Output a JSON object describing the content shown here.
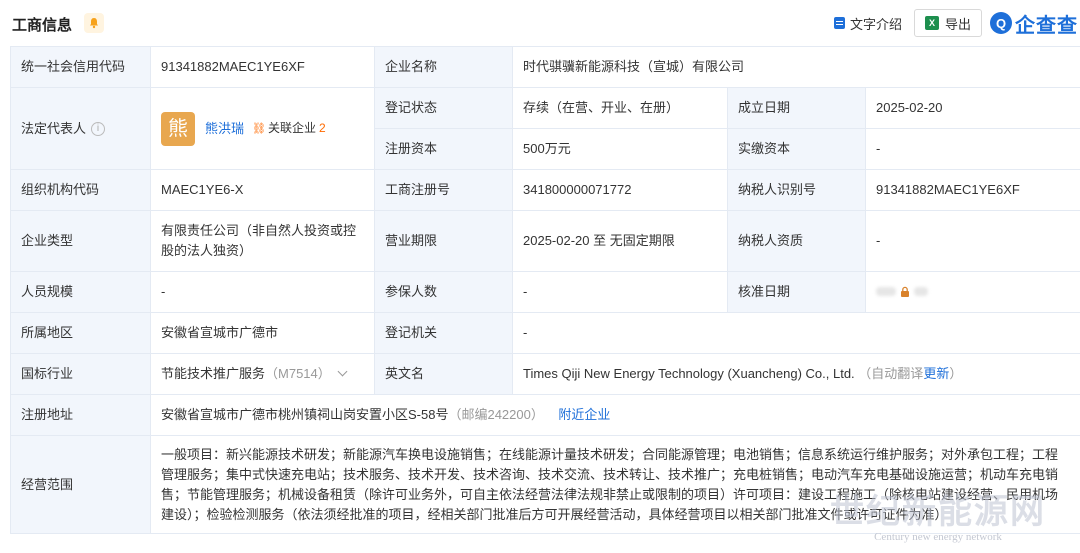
{
  "header": {
    "title": "工商信息",
    "tools": {
      "text_intro": "文字介绍",
      "export": "导出",
      "brand": "企查查",
      "brand_logo_char": "Q"
    }
  },
  "fields": {
    "credit_code": {
      "label": "统一社会信用代码",
      "value": "91341882MAEC1YE6XF"
    },
    "company_name": {
      "label": "企业名称",
      "value": "时代骐骥新能源科技（宣城）有限公司"
    },
    "legal_rep": {
      "label": "法定代表人",
      "avatar_char": "熊",
      "name": "熊洪瑞",
      "related_label": "关联企业",
      "related_count": "2"
    },
    "reg_status": {
      "label": "登记状态",
      "value": "存续（在营、开业、在册）"
    },
    "founded": {
      "label": "成立日期",
      "value": "2025-02-20"
    },
    "reg_capital": {
      "label": "注册资本",
      "value": "500万元"
    },
    "paid_capital": {
      "label": "实缴资本",
      "value": "-"
    },
    "org_code": {
      "label": "组织机构代码",
      "value": "MAEC1YE6-X"
    },
    "reg_no": {
      "label": "工商注册号",
      "value": "341800000071772"
    },
    "taxpayer_id": {
      "label": "纳税人识别号",
      "value": "91341882MAEC1YE6XF"
    },
    "company_type": {
      "label": "企业类型",
      "value": "有限责任公司（非自然人投资或控股的法人独资）"
    },
    "business_term": {
      "label": "营业期限",
      "value": "2025-02-20 至 无固定期限"
    },
    "taxpayer_qual": {
      "label": "纳税人资质",
      "value": "-"
    },
    "staff_size": {
      "label": "人员规模",
      "value": "-"
    },
    "insured": {
      "label": "参保人数",
      "value": "-"
    },
    "approval_date": {
      "label": "核准日期",
      "value": ""
    },
    "region": {
      "label": "所属地区",
      "value": "安徽省宣城市广德市"
    },
    "reg_authority": {
      "label": "登记机关",
      "value": "-"
    },
    "industry": {
      "label": "国标行业",
      "value": "节能技术推广服务",
      "code": "（M7514）"
    },
    "english_name": {
      "label": "英文名",
      "value": "Times Qiji New Energy Technology (Xuancheng) Co., Ltd.",
      "note": "（自动翻译",
      "update": "更新",
      "note_end": "）"
    },
    "address": {
      "label": "注册地址",
      "value": "安徽省宣城市广德市桃州镇祠山岗安置小区S-58号",
      "postcode": "（邮编242200）",
      "nearby": "附近企业"
    },
    "scope": {
      "label": "经营范围",
      "value": "一般项目：新兴能源技术研发；新能源汽车换电设施销售；在线能源计量技术研发；合同能源管理；电池销售；信息系统运行维护服务；对外承包工程；工程管理服务；集中式快速充电站；技术服务、技术开发、技术咨询、技术交流、技术转让、技术推广；充电桩销售；电动汽车充电基础设施运营；机动车充电销售；节能管理服务；机械设备租赁（除许可业务外，可自主依法经营法律法规非禁止或限制的项目）许可项目：建设工程施工（除核电站建设经营、民用机场建设）；检验检测服务（依法须经批准的项目，经相关部门批准后方可开展经营活动，具体经营项目以相关部门批准文件或许可证件为准）"
    }
  },
  "watermark": {
    "main": "世纪新能源网",
    "sub": "Century new energy network"
  },
  "colors": {
    "label_bg": "#f2f6fc",
    "border": "#e4eaf3",
    "link": "#1e6fd9",
    "accent_orange": "#ff6a00",
    "avatar": "#e8a74f"
  }
}
